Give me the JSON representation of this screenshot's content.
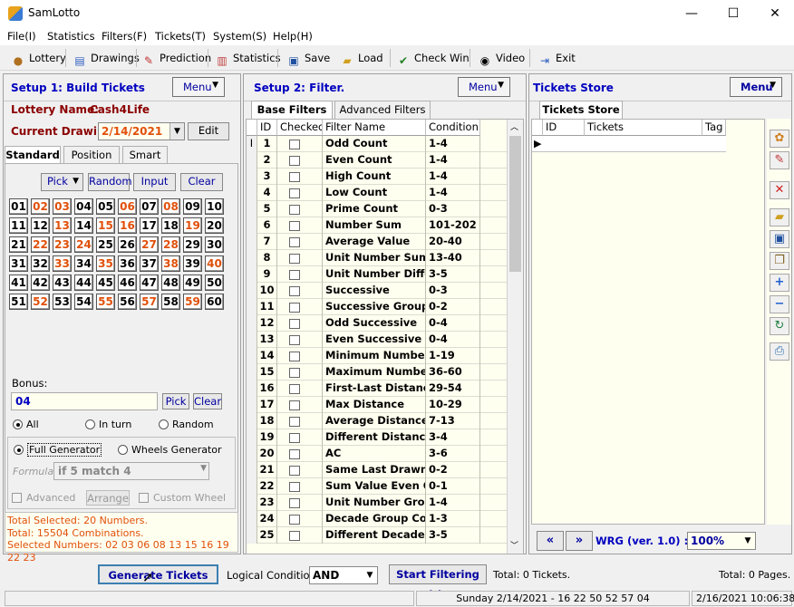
{
  "window": {
    "title": "SamLotto",
    "minimize": "—",
    "maximize": "☐",
    "close": "✕"
  },
  "menubar": [
    "File(I)",
    "Statistics",
    "Filters(F)",
    "Tickets(T)",
    "System(S)",
    "Help(H)"
  ],
  "toolbar": {
    "lottery": "Lottery",
    "drawings": "Drawings",
    "prediction": "Prediction",
    "statistics": "Statistics",
    "save": "Save",
    "load": "Load",
    "check_win": "Check Win",
    "video": "Video",
    "exit": "Exit"
  },
  "setup1": {
    "title": "Setup 1:  Build  Tickets",
    "menu": "Menu",
    "lottery_label": "Lottery  Name:",
    "lottery_name": "Cash4Life",
    "drawing_label": "Current Drawing:",
    "drawing_value": "2/14/2021",
    "edit": "Edit",
    "tabs": [
      "Standard",
      "Position",
      "Smart"
    ],
    "pick": "Pick",
    "random": "Random",
    "input": "Input",
    "clear": "Clear",
    "numbers": [
      "01",
      "02",
      "03",
      "04",
      "05",
      "06",
      "07",
      "08",
      "09",
      "10",
      "11",
      "12",
      "13",
      "14",
      "15",
      "16",
      "17",
      "18",
      "19",
      "20",
      "21",
      "22",
      "23",
      "24",
      "25",
      "26",
      "27",
      "28",
      "29",
      "30",
      "31",
      "32",
      "33",
      "34",
      "35",
      "36",
      "37",
      "38",
      "39",
      "40",
      "41",
      "42",
      "43",
      "44",
      "45",
      "46",
      "47",
      "48",
      "49",
      "50",
      "51",
      "52",
      "53",
      "54",
      "55",
      "56",
      "57",
      "58",
      "59",
      "60"
    ],
    "selected": [
      "02",
      "03",
      "06",
      "08",
      "13",
      "15",
      "16",
      "19",
      "22",
      "23",
      "24",
      "27",
      "28",
      "33",
      "35",
      "38",
      "40",
      "52",
      "55",
      "57",
      "59"
    ],
    "highlight_color": "#e0500a",
    "bonus_label": "Bonus:",
    "bonus_value": "04",
    "bonus_pick": "Pick",
    "bonus_clear": "Clear",
    "radio_all": "All",
    "radio_inturn": "In turn",
    "radio_random": "Random",
    "full_generator": "Full Generator",
    "wheels_generator": "Wheels Generator",
    "formula_label": "Formula:",
    "formula_value": "if 5 match 4",
    "advanced": "Advanced",
    "arrange": "Arrange",
    "custom_wheel": "Custom Wheel",
    "summary": [
      "Total Selected: 20 Numbers.",
      "Total: 15504 Combinations.",
      "Selected Numbers: 02 03 06 08 13 15 16 19 22 23"
    ]
  },
  "setup2": {
    "title": "Setup 2:  Filter.",
    "menu": "Menu",
    "tabs": [
      "Base Filters",
      "Advanced Filters"
    ],
    "columns": [
      "ID",
      "Checked",
      "Filter Name",
      "Condition"
    ],
    "rows": [
      [
        "1",
        "Odd Count",
        "1-4"
      ],
      [
        "2",
        "Even Count",
        "1-4"
      ],
      [
        "3",
        "High Count",
        "1-4"
      ],
      [
        "4",
        "Low Count",
        "1-4"
      ],
      [
        "5",
        "Prime Count",
        "0-3"
      ],
      [
        "6",
        "Number Sum",
        "101-202"
      ],
      [
        "7",
        "Average Value",
        "20-40"
      ],
      [
        "8",
        "Unit Number Sum",
        "13-40"
      ],
      [
        "9",
        "Unit Number Differe",
        "3-5"
      ],
      [
        "10",
        "Successive",
        "0-3"
      ],
      [
        "11",
        "Successive Groups",
        "0-2"
      ],
      [
        "12",
        "Odd Successive",
        "0-4"
      ],
      [
        "13",
        "Even Successive",
        "0-4"
      ],
      [
        "14",
        "Minimum Number",
        "1-19"
      ],
      [
        "15",
        "Maximum Number",
        "36-60"
      ],
      [
        "16",
        "First-Last Distance",
        "29-54"
      ],
      [
        "17",
        "Max Distance",
        "10-29"
      ],
      [
        "18",
        "Average Distance",
        "7-13"
      ],
      [
        "19",
        "Different Distance",
        "3-4"
      ],
      [
        "20",
        "AC",
        "3-6"
      ],
      [
        "21",
        "Same Last Drawn",
        "0-2"
      ],
      [
        "22",
        "Sum Value Even Od",
        "0-1"
      ],
      [
        "23",
        "Unit Number Group",
        "1-4"
      ],
      [
        "24",
        "Decade Group Cour",
        "1-3"
      ],
      [
        "25",
        "Different Decade Co",
        "3-5"
      ]
    ]
  },
  "store": {
    "title": "Tickets Store",
    "menu": "Menu",
    "tab": "Tickets Store",
    "columns": [
      "ID",
      "Tickets",
      "Tag"
    ],
    "wrg": "WRG (ver. 1.0) :",
    "zoom": "100%"
  },
  "bottom": {
    "generate": "Generate Tickets >>",
    "logical_label": "Logical Condition:",
    "logical_value": "AND",
    "start_filtering": "Start Filtering >>",
    "total_tickets": "Total: 0 Tickets.",
    "total_pages": "Total: 0 Pages."
  },
  "status": {
    "draw": "Sunday 2/14/2021 - 16 22 50 52 57 04",
    "datetime": "2/16/2021 10:06:38 A"
  }
}
